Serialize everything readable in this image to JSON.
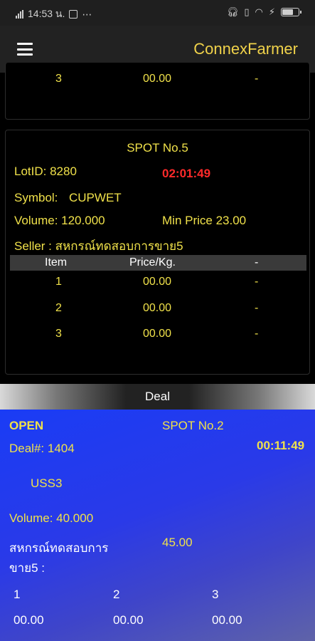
{
  "status_bar": {
    "time": "14:53 น.",
    "dots": "⋯"
  },
  "app_bar": {
    "title": "ConnexFarmer"
  },
  "prev_card": {
    "row": {
      "item": "3",
      "price": "00.00",
      "extra": "-"
    }
  },
  "spot_card": {
    "title": "SPOT No.5",
    "lot_id": "LotID: 8280",
    "timer": "02:01:49",
    "symbol_label": "Symbol:",
    "symbol_value": "CUPWET",
    "volume": "Volume: 120.000",
    "min_price": "Min Price 23.00",
    "seller": "Seller : สหกรณ์ทดสอบการขาย5",
    "headers": {
      "item": "Item",
      "price": "Price/Kg.",
      "extra": "-"
    },
    "rows": [
      {
        "item": "1",
        "price": "00.00",
        "extra": "-"
      },
      {
        "item": "2",
        "price": "00.00",
        "extra": "-"
      },
      {
        "item": "3",
        "price": "00.00",
        "extra": "-"
      }
    ]
  },
  "deal_section": {
    "header": "Deal"
  },
  "deal_card": {
    "status": "OPEN",
    "spot": "SPOT No.2",
    "deal_no": "Deal#: 1404",
    "timer": "00:11:49",
    "symbol": "USS3",
    "volume": "Volume: 40.000",
    "seller_line1": "สหกรณ์ทดสอบการ",
    "seller_line2": "ขาย5 :",
    "price": "45.00",
    "items": [
      "1",
      "2",
      "3"
    ],
    "values": [
      "00.00",
      "00.00",
      "00.00"
    ]
  },
  "colors": {
    "accent_yellow": "#f0e14a",
    "timer_red": "#ff2a2a",
    "title_yellow": "#f0d24a",
    "deal_blue": "#1a3cf5"
  }
}
